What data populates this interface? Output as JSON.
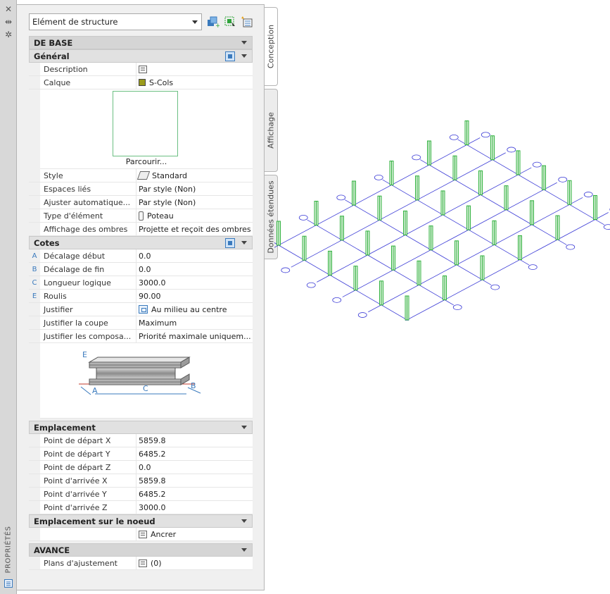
{
  "strip": {
    "title": "PROPRIÉTÉS",
    "icons": [
      "close-icon",
      "auto-hide-icon",
      "settings-icon",
      "quick-properties-icon"
    ]
  },
  "toolbar": {
    "object_type": "Elément de structure",
    "buttons": [
      "add-selection-icon",
      "quick-select-icon",
      "select-objects-icon"
    ]
  },
  "tabs": [
    "Conception",
    "Affichage",
    "Données étendues"
  ],
  "sections": {
    "base": {
      "title": "DE BASE"
    },
    "general": {
      "title": "Général",
      "rows": [
        {
          "label": "Description",
          "value": ""
        },
        {
          "label": "Calque",
          "value": "S-Cols"
        }
      ],
      "browse": "Parcourir...",
      "rows2": [
        {
          "label": "Style",
          "value": "Standard"
        },
        {
          "label": "Espaces liés",
          "value": "Par style (Non)"
        },
        {
          "label": "Ajuster  automatique...",
          "value": "Par style (Non)"
        },
        {
          "label": "Type d'élément",
          "value": "Poteau"
        },
        {
          "label": "Affichage des ombres",
          "value": "Projette et reçoit des ombres"
        }
      ]
    },
    "dimensions": {
      "title": "Cotes",
      "rows": [
        {
          "key": "A",
          "label": "Décalage début",
          "value": "0.0"
        },
        {
          "key": "B",
          "label": "Décalage de fin",
          "value": "0.0"
        },
        {
          "key": "C",
          "label": "Longueur logique",
          "value": "3000.0"
        },
        {
          "key": "E",
          "label": "Roulis",
          "value": "90.00"
        },
        {
          "key": "",
          "label": "Justifier",
          "value": "Au milieu au centre"
        },
        {
          "key": "",
          "label": "Justifier la coupe",
          "value": "Maximum"
        },
        {
          "key": "",
          "label": "Justifier  les  composa...",
          "value": "Priorité maximale uniquem..."
        }
      ],
      "diagram_labels": {
        "e": "E",
        "a": "A",
        "c": "C",
        "b": "B"
      }
    },
    "location": {
      "title": "Emplacement",
      "rows": [
        {
          "label": "Point de départ X",
          "value": "5859.8"
        },
        {
          "label": "Point de départ Y",
          "value": "6485.2"
        },
        {
          "label": "Point de départ Z",
          "value": "0.0"
        },
        {
          "label": "Point d'arrivée X",
          "value": "5859.8"
        },
        {
          "label": "Point d'arrivée Y",
          "value": "6485.2"
        },
        {
          "label": "Point d'arrivée Z",
          "value": "3000.0"
        }
      ]
    },
    "node": {
      "title": "Emplacement sur le noeud",
      "value": "Ancrer"
    },
    "advanced": {
      "title": "AVANCE",
      "rows": [
        {
          "label": "Plans d'ajustement",
          "value": "(0)"
        }
      ]
    }
  },
  "colors": {
    "column": "#2fb13d",
    "grid": "#3b3bd6",
    "accent": "#3a7abd"
  }
}
